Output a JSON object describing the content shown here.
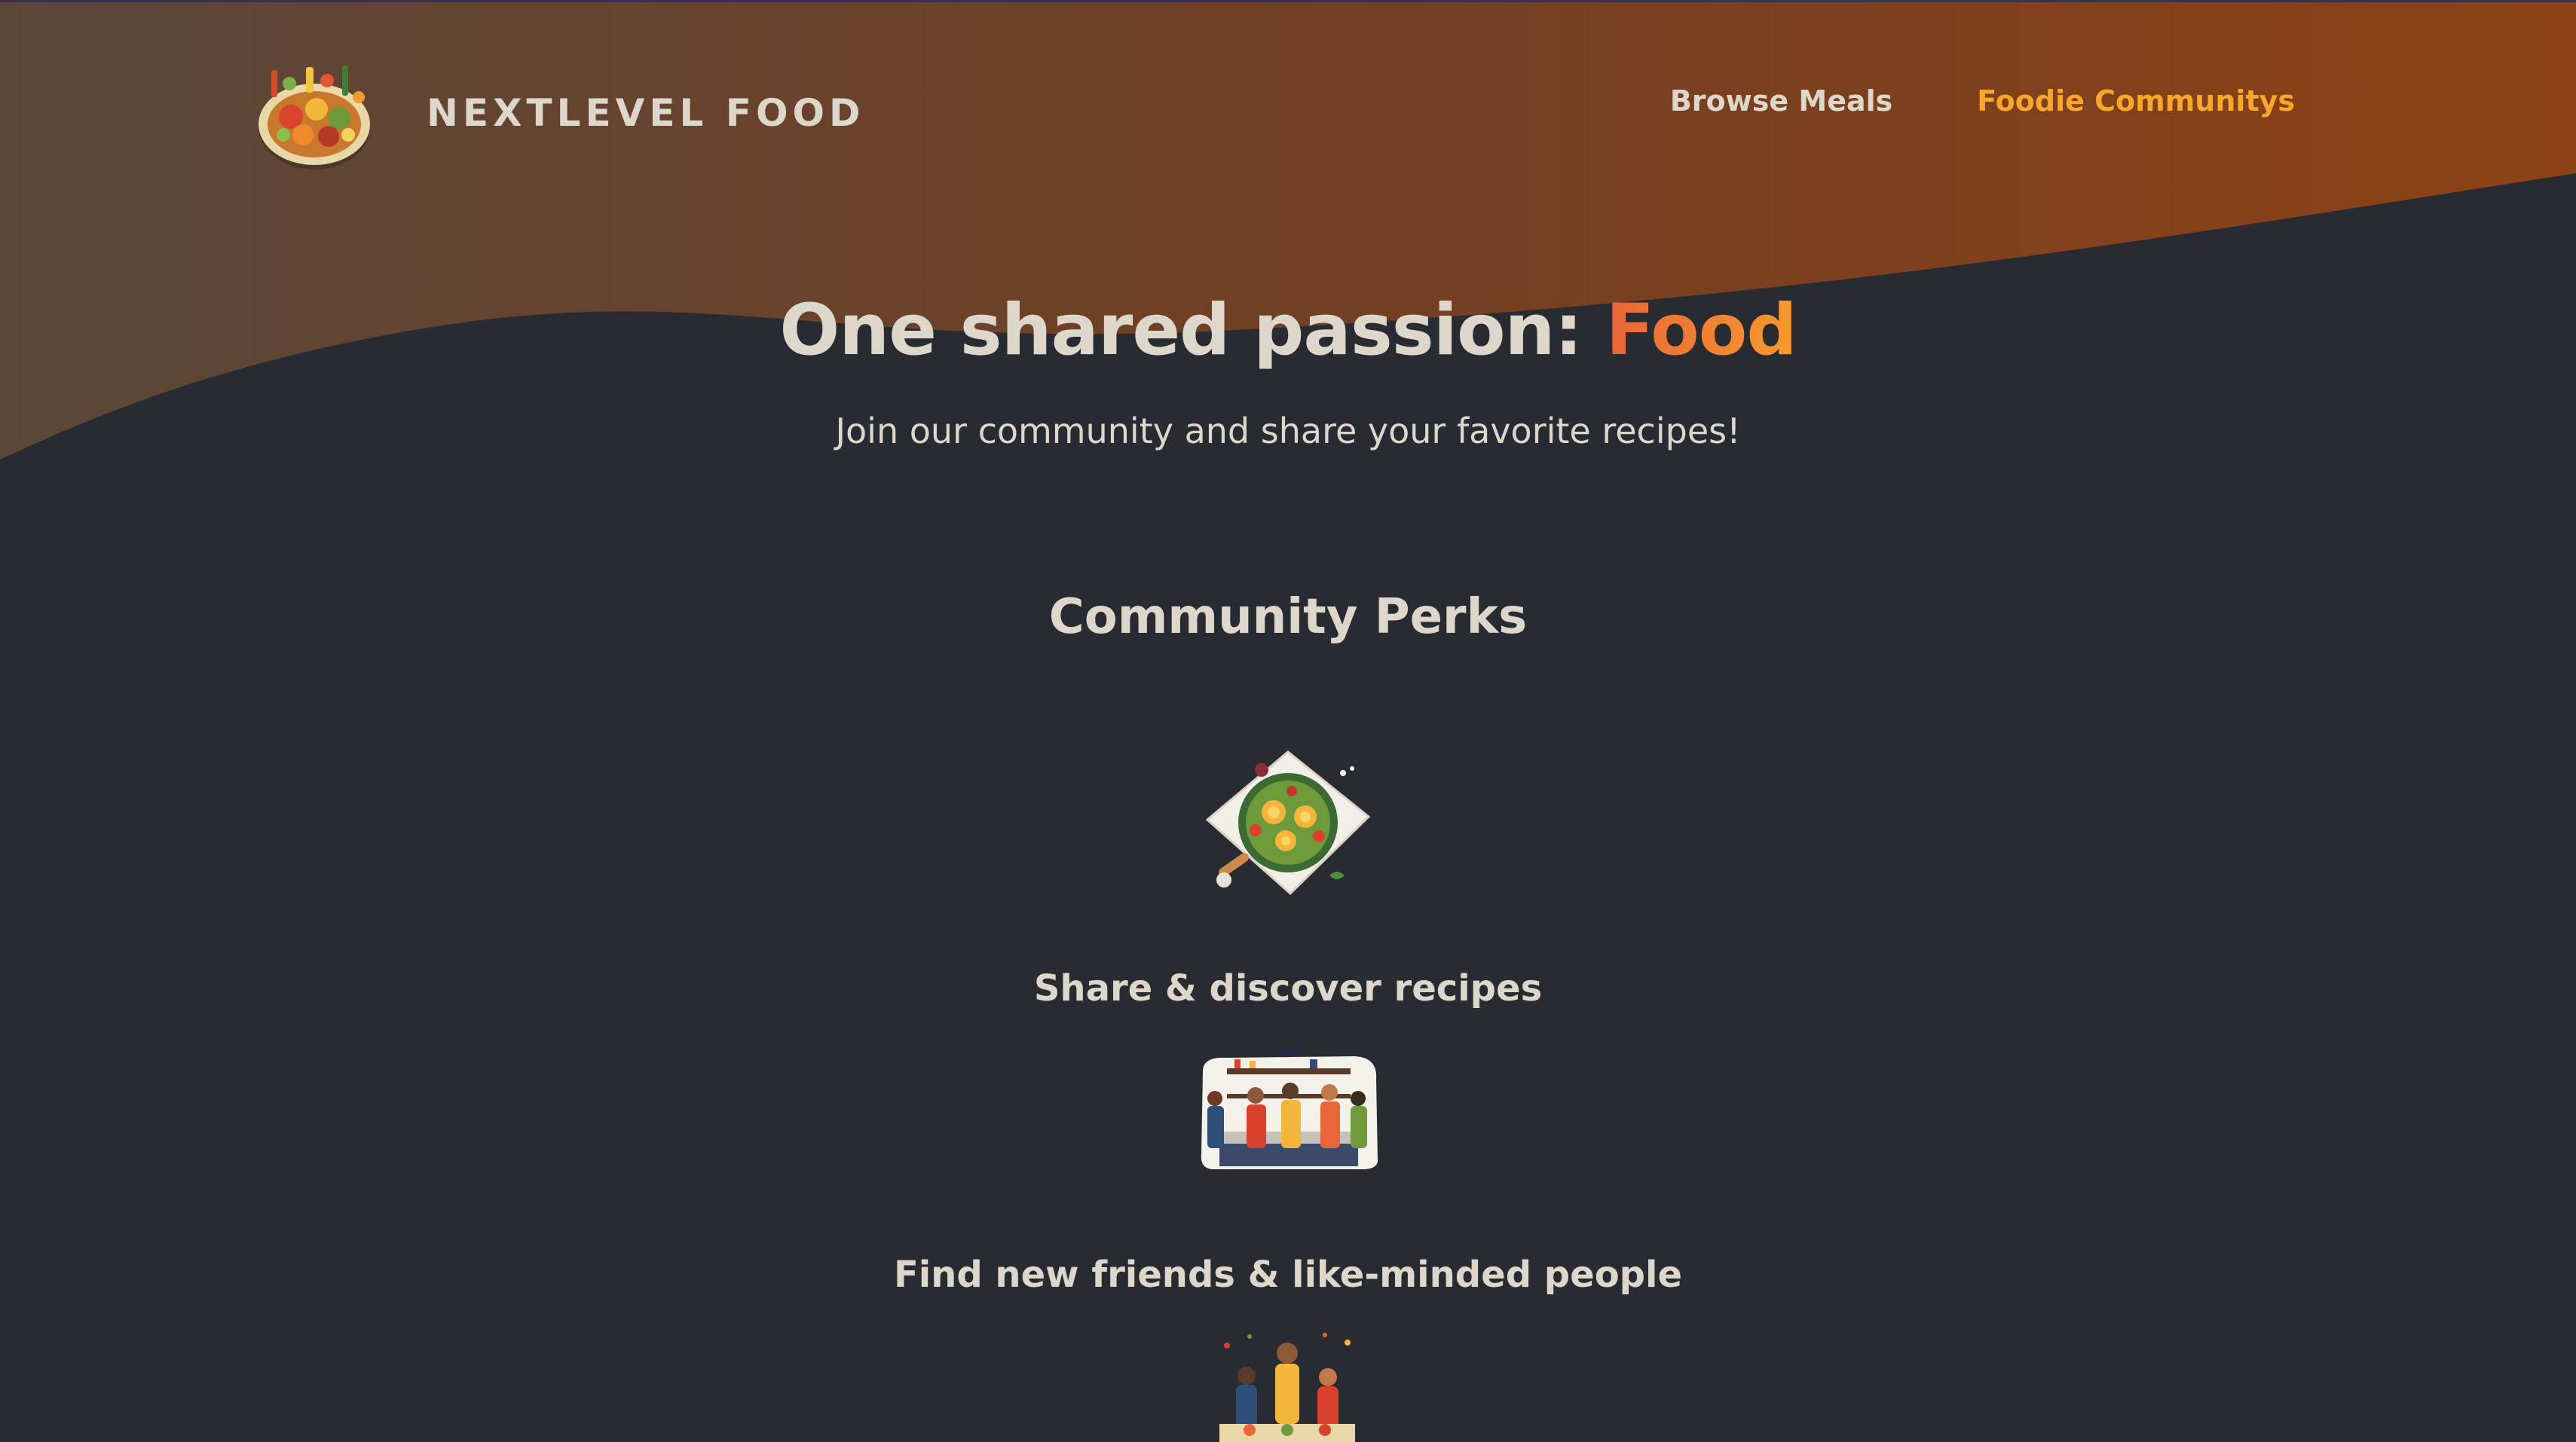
{
  "header": {
    "logo_text": "NEXTLEVEL FOOD",
    "nav": [
      {
        "label": "Browse Meals",
        "active": false
      },
      {
        "label": "Foodie Communitys",
        "active": true
      }
    ]
  },
  "hero": {
    "title_main": "One shared passion: ",
    "title_accent": "Food",
    "subtitle": "Join our community and share your favorite recipes!"
  },
  "perks": {
    "title": "Community Perks",
    "items": [
      {
        "label": "Share & discover recipes",
        "icon": "recipe-dish-illustration"
      },
      {
        "label": "Find new friends & like-minded people",
        "icon": "kitchen-friends-illustration"
      },
      {
        "label": "",
        "icon": "cooking-event-illustration"
      }
    ]
  },
  "colors": {
    "background": "#282c32",
    "text": "#ddd6cb",
    "accent_orange": "#f9a72a",
    "accent_red_orange": "#e8663a",
    "header_gradient_start": "#5a4535",
    "header_gradient_end": "#8a4316"
  }
}
